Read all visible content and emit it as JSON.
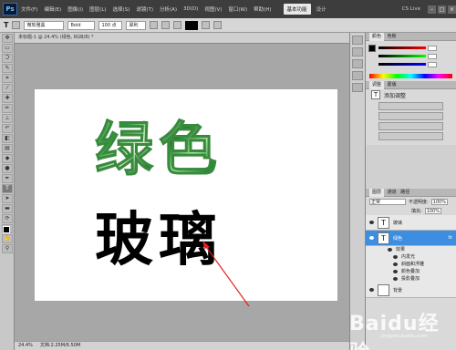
{
  "menubar": {
    "logo": "Ps",
    "items": [
      "文件(F)",
      "编辑(E)",
      "图像(I)",
      "图层(L)",
      "选择(S)",
      "滤镜(T)",
      "分析(A)",
      "3D(D)",
      "视图(V)",
      "窗口(W)",
      "帮助(H)"
    ],
    "zoom": "24.4",
    "workspace_active": "基本功能",
    "workspace_other": "设计",
    "cs_live": "CS Live"
  },
  "optbar": {
    "tool": "T",
    "font_family": "微软雅黑",
    "font_style": "Bold",
    "font_size": "100 点",
    "antialias": "犀利"
  },
  "document": {
    "tab": "未标题-1 @ 24.4% (绿色, RGB/8) *",
    "green_text": "绿色",
    "black_text": "玻璃",
    "status_zoom": "24.4%",
    "status_doc": "文档:2.25M/6.50M"
  },
  "panels": {
    "color_tab": "颜色",
    "swatches_tab": "色板",
    "adjust_tab": "调整",
    "masks_tab": "蒙版",
    "adjust_title": "添加调整",
    "adjust_buttons": [
      "",
      "",
      "",
      ""
    ],
    "layers_tab": "图层",
    "channels_tab": "通道",
    "paths_tab": "路径",
    "blend_mode": "正常",
    "opacity_label": "不透明度:",
    "opacity_value": "100%",
    "fill_label": "填充:",
    "fill_value": "100%",
    "layers": [
      {
        "name": "玻璃",
        "type": "T",
        "selected": false
      },
      {
        "name": "绿色",
        "type": "T",
        "selected": true,
        "fx": "fx"
      },
      {
        "name": "背景",
        "type": "bg",
        "selected": false
      }
    ],
    "effects_title": "效果",
    "effects": [
      "内发光",
      "斜面和浮雕",
      "颜色叠加",
      "投影叠加"
    ]
  },
  "watermark": {
    "brand": "Baidu经验",
    "url": "jingyan.baidu.com"
  }
}
